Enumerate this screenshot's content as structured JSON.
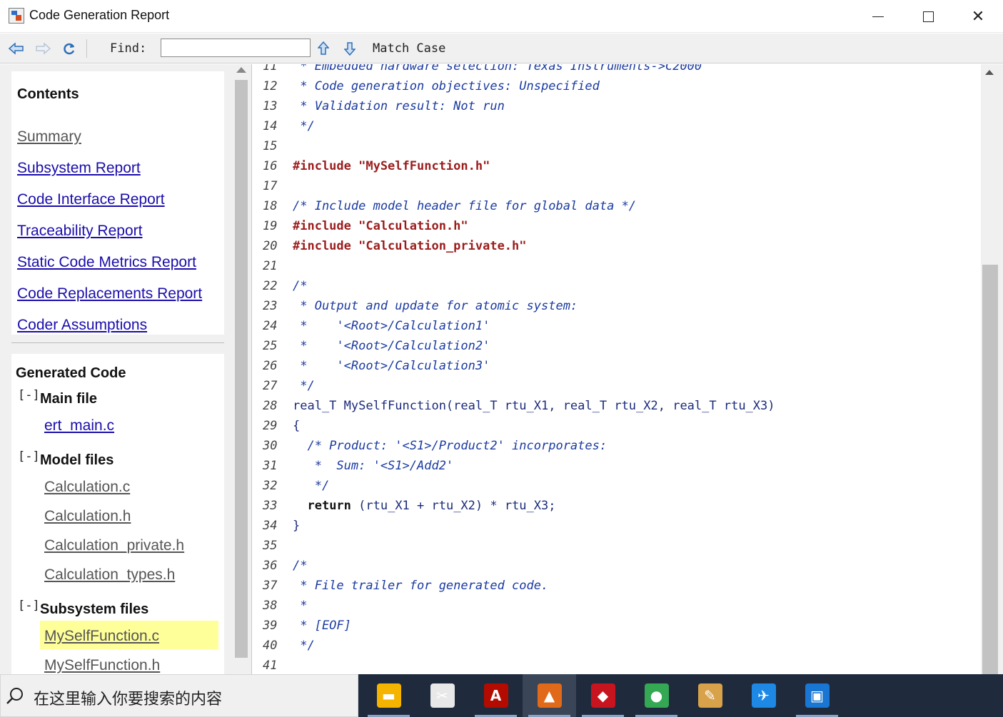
{
  "window": {
    "title": "Code Generation Report"
  },
  "toolbar": {
    "find_label": "Find:",
    "find_value": "",
    "match_case_label": "Match Case"
  },
  "sidebar": {
    "contents_title": "Contents",
    "links": [
      {
        "label": "Summary",
        "visited": true
      },
      {
        "label": "Subsystem Report",
        "visited": false
      },
      {
        "label": "Code Interface Report",
        "visited": false
      },
      {
        "label": "Traceability Report",
        "visited": false
      },
      {
        "label": "Static Code Metrics Report",
        "visited": false
      },
      {
        "label": "Code Replacements Report",
        "visited": false
      },
      {
        "label": "Coder Assumptions",
        "visited": false
      }
    ],
    "generated_code_title": "Generated Code",
    "toggle_symbol": "[-]",
    "sections": {
      "main": {
        "title": "Main file",
        "files": [
          "ert_main.c"
        ]
      },
      "model": {
        "title": "Model files",
        "files": [
          "Calculation.c",
          "Calculation.h",
          "Calculation_private.h",
          "Calculation_types.h"
        ]
      },
      "subsystem": {
        "title": "Subsystem files",
        "files": [
          "MySelfFunction.c",
          "MySelfFunction.h"
        ],
        "selected": "MySelfFunction.c"
      }
    }
  },
  "code": {
    "lines": [
      {
        "n": "11",
        "text": " * Embedded hardware selection: Texas Instruments->C2000",
        "kind": "comment"
      },
      {
        "n": "12",
        "text": " * Code generation objectives: Unspecified",
        "kind": "comment"
      },
      {
        "n": "13",
        "text": " * Validation result: Not run",
        "kind": "comment"
      },
      {
        "n": "14",
        "text": " */",
        "kind": "comment"
      },
      {
        "n": "15",
        "text": "",
        "kind": "plain"
      },
      {
        "n": "16",
        "text": "#include \"MySelfFunction.h\"",
        "kind": "pp"
      },
      {
        "n": "17",
        "text": "",
        "kind": "plain"
      },
      {
        "n": "18",
        "text": "/* Include model header file for global data */",
        "kind": "comment"
      },
      {
        "n": "19",
        "text": "#include \"Calculation.h\"",
        "kind": "pp"
      },
      {
        "n": "20",
        "text": "#include \"Calculation_private.h\"",
        "kind": "pp"
      },
      {
        "n": "21",
        "text": "",
        "kind": "plain"
      },
      {
        "n": "22",
        "text": "/*",
        "kind": "comment"
      },
      {
        "n": "23",
        "text": " * Output and update for atomic system:",
        "kind": "comment"
      },
      {
        "n": "24",
        "text": " *    '<Root>/Calculation1'",
        "kind": "comment"
      },
      {
        "n": "25",
        "text": " *    '<Root>/Calculation2'",
        "kind": "comment"
      },
      {
        "n": "26",
        "text": " *    '<Root>/Calculation3'",
        "kind": "comment"
      },
      {
        "n": "27",
        "text": " */",
        "kind": "comment"
      },
      {
        "n": "28",
        "text": "real_T MySelfFunction(real_T rtu_X1, real_T rtu_X2, real_T rtu_X3)",
        "kind": "plain"
      },
      {
        "n": "29",
        "text": "{",
        "kind": "plain"
      },
      {
        "n": "30",
        "text": "  /* Product: '<S1>/Product2' incorporates:",
        "kind": "comment"
      },
      {
        "n": "31",
        "text": "   *  Sum: '<S1>/Add2'",
        "kind": "comment"
      },
      {
        "n": "32",
        "text": "   */",
        "kind": "comment"
      },
      {
        "n": "33",
        "text": "  return (rtu_X1 + rtu_X2) * rtu_X3;",
        "kind": "return"
      },
      {
        "n": "34",
        "text": "}",
        "kind": "plain"
      },
      {
        "n": "35",
        "text": "",
        "kind": "plain"
      },
      {
        "n": "36",
        "text": "/*",
        "kind": "comment"
      },
      {
        "n": "37",
        "text": " * File trailer for generated code.",
        "kind": "comment"
      },
      {
        "n": "38",
        "text": " *",
        "kind": "comment"
      },
      {
        "n": "39",
        "text": " * [EOF]",
        "kind": "comment"
      },
      {
        "n": "40",
        "text": " */",
        "kind": "comment"
      },
      {
        "n": "41",
        "text": "",
        "kind": "plain"
      }
    ]
  },
  "taskbar": {
    "search_placeholder": "在这里输入你要搜索的内容",
    "apps": [
      {
        "icon": "file-explorer-icon",
        "color": "#f4b400",
        "active": false,
        "underline": true
      },
      {
        "icon": "snipping-tool-icon",
        "color": "#e8e8e8",
        "active": false,
        "underline": false
      },
      {
        "icon": "acrobat-reader-icon",
        "color": "#b30b00",
        "active": false,
        "underline": true
      },
      {
        "icon": "matlab-icon",
        "color": "#e16a1a",
        "active": true,
        "underline": true
      },
      {
        "icon": "cad-3d-icon",
        "color": "#c8141e",
        "active": false,
        "underline": true
      },
      {
        "icon": "chrome-icon",
        "color": "#34a853",
        "active": false,
        "underline": true
      },
      {
        "icon": "paint-icon",
        "color": "#d8a24a",
        "active": false,
        "underline": false
      },
      {
        "icon": "feishu-icon",
        "color": "#1e88e5",
        "active": false,
        "underline": false
      },
      {
        "icon": "photos-icon",
        "color": "#1976d2",
        "active": false,
        "underline": true
      }
    ]
  }
}
